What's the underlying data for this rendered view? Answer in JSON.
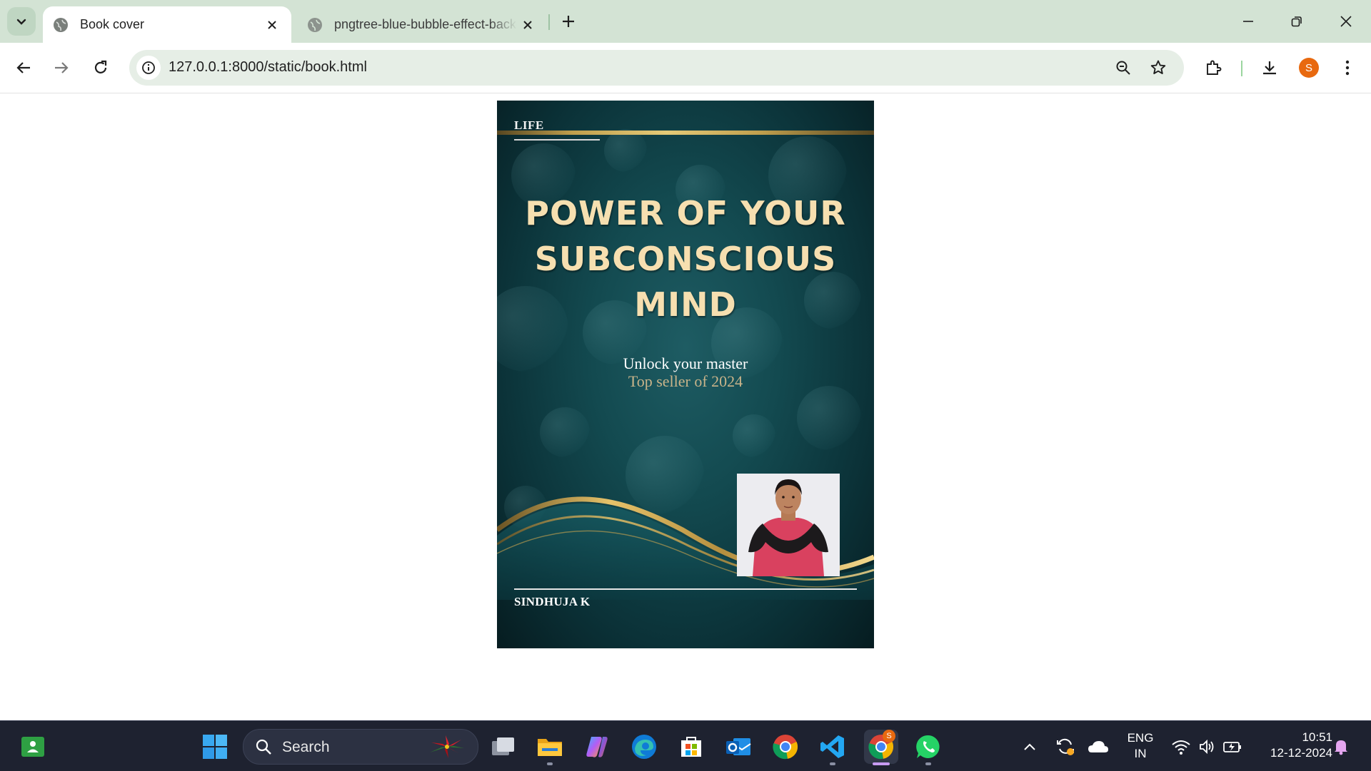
{
  "browser": {
    "tabs": [
      {
        "title": "Book cover",
        "active": true
      },
      {
        "title": "pngtree-blue-bubble-effect-background",
        "active": false
      }
    ],
    "url": "127.0.0.1:8000/static/book.html",
    "profile_initial": "S"
  },
  "cover": {
    "category": "LIFE",
    "title": "POWER OF YOUR SUBCONSCIOUS MIND",
    "subtitle": "Unlock your master",
    "tagline": "Top seller of 2024",
    "author": "SINDHUJA K"
  },
  "taskbar": {
    "search_label": "Search",
    "language_line1": "ENG",
    "language_line2": "IN",
    "time": "10:51",
    "date": "12-12-2024",
    "chrome_badge": "S"
  },
  "colors": {
    "tabbar": "#d3e3d4",
    "cover_teal": "#134a50",
    "title_cream": "#f6dfb0",
    "gold": "#d7b35f",
    "taskbar": "#1e2230"
  }
}
